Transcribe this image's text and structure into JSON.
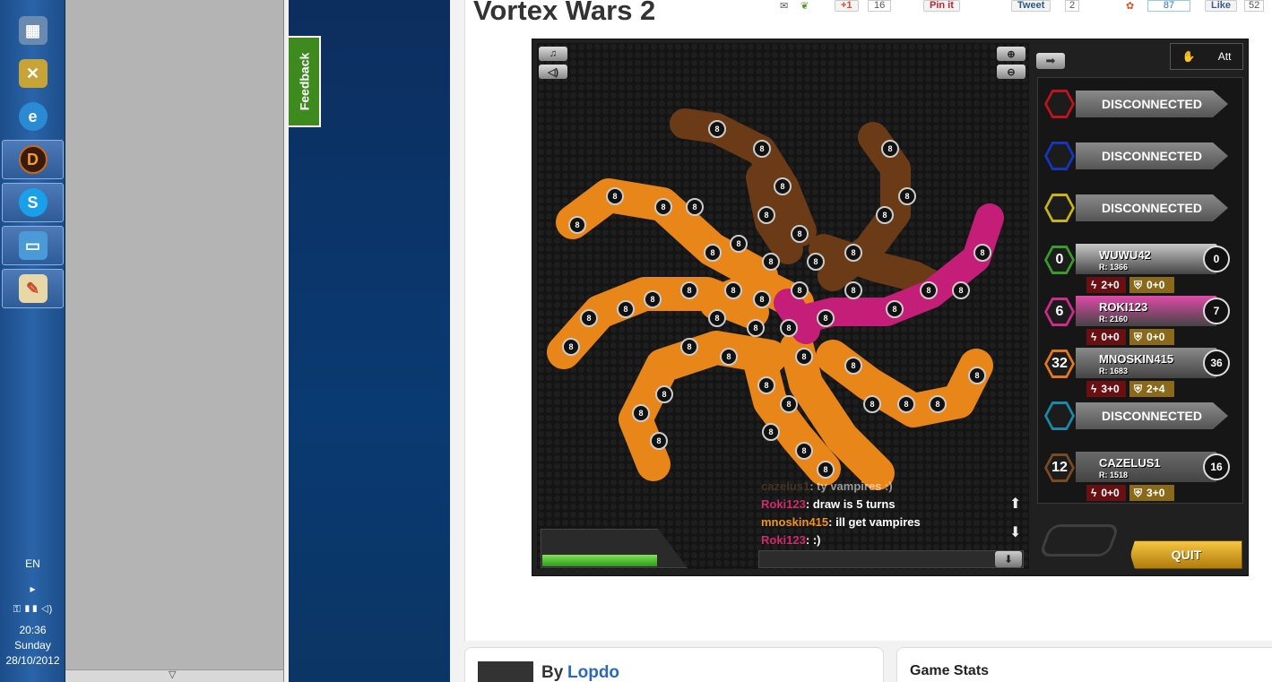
{
  "taskbar": {
    "language": "EN",
    "time": "20:36",
    "day": "Sunday",
    "date": "28/10/2012"
  },
  "feedback_label": "Feedback",
  "page": {
    "title": "Vortex Wars 2",
    "share": {
      "gplus_label": "+1",
      "gplus_count": "16",
      "pinit_label": "Pin it",
      "tweet_label": "Tweet",
      "tweet_count": "2",
      "stumble_count": "87",
      "like_label": "Like",
      "like_count": "52"
    },
    "by_label": "By",
    "author": "Lopdo",
    "game_stats_label": "Game Stats"
  },
  "game": {
    "side_panel_toggle": "Att",
    "unit_strength": "8",
    "slots": [
      {
        "type": "disconnected",
        "label": "DISCONNECTED",
        "color": "#c0141c"
      },
      {
        "type": "disconnected",
        "label": "DISCONNECTED",
        "color": "#1436c0"
      },
      {
        "type": "disconnected",
        "label": "DISCONNECTED",
        "color": "#c8b414"
      },
      {
        "type": "player",
        "count": "0",
        "name": "WUWU42",
        "rating": "R: 1366",
        "score": "0",
        "attack": "2+0",
        "defense": "0+0",
        "color": "#3a9a2a",
        "bar": "#c8c8c8"
      },
      {
        "type": "player",
        "count": "6",
        "name": "ROKI123",
        "rating": "R: 2160",
        "score": "7",
        "attack": "0+0",
        "defense": "0+0",
        "color": "#d02a8a",
        "bar": "#e04aa8"
      },
      {
        "type": "player",
        "count": "32",
        "name": "MNOSKIN415",
        "rating": "R: 1683",
        "score": "36",
        "attack": "3+0",
        "defense": "2+4",
        "color": "#e6781a",
        "bar": "#8a8a8a"
      },
      {
        "type": "disconnected",
        "label": "DISCONNECTED",
        "color": "#1a8aaa"
      },
      {
        "type": "player",
        "count": "12",
        "name": "CAZELUS1",
        "rating": "R: 1518",
        "score": "16",
        "attack": "0+0",
        "defense": "3+0",
        "color": "#7a4a22",
        "bar": "#6a6a6a"
      }
    ],
    "chat": [
      {
        "user": "cazelus1",
        "text": ": ty vampires :)",
        "color": "#6a4a2a",
        "dim": true
      },
      {
        "user": "Roki123",
        "text": ": draw is 5 turns",
        "color": "#d02a6a",
        "dim": false
      },
      {
        "user": "mnoskin415",
        "text": ": ill get vampires",
        "color": "#f0921e",
        "dim": false
      },
      {
        "user": "Roki123",
        "text": ": :)",
        "color": "#d02a6a",
        "dim": false
      }
    ],
    "quit_label": "QUIT",
    "power_fraction": 0.78
  },
  "colors": {
    "orange_territory": "#e8861a",
    "brown_territory": "#6b3a16",
    "pink_territory": "#c41e78"
  }
}
